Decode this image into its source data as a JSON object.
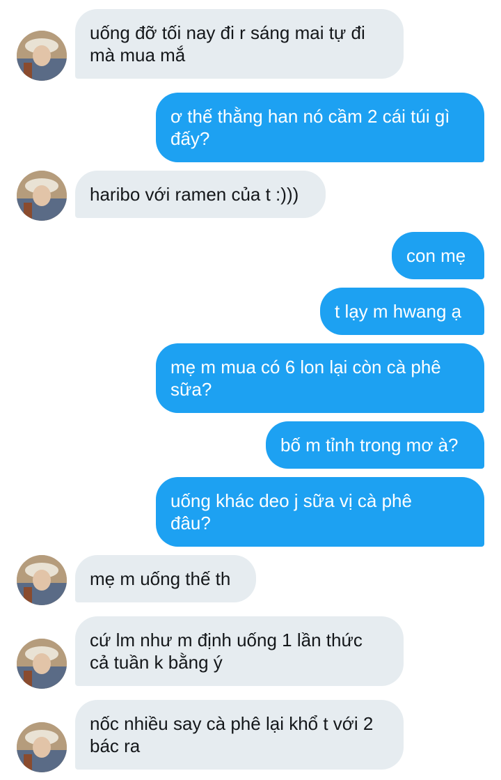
{
  "conversation": {
    "messages": [
      {
        "direction": "in",
        "text": "uống đỡ tối nay đi r sáng mai tự đi\nmà mua mắ"
      },
      {
        "direction": "out",
        "text": "ơ thế thằng han nó cầm 2 cái túi gì\nđấy?"
      },
      {
        "direction": "in",
        "text": "haribo với ramen của t :)))"
      },
      {
        "direction": "out",
        "text": "con mẹ"
      },
      {
        "direction": "out",
        "text": "t lạy m hwang ạ"
      },
      {
        "direction": "out",
        "text": "mẹ m mua có 6 lon lại còn cà phê\nsữa?"
      },
      {
        "direction": "out",
        "text": "bố m tỉnh trong mơ à?"
      },
      {
        "direction": "out",
        "text": "uống khác deo j sữa vị cà phê\nđâu?"
      },
      {
        "direction": "in",
        "text": "mẹ m uống thế th"
      },
      {
        "direction": "in",
        "text": "cứ lm như m định uống 1 lần thức\ncả tuần k bằng ý"
      },
      {
        "direction": "in",
        "text": "nốc nhiều say cà phê lại khổ t với 2\nbác ra"
      }
    ]
  },
  "colors": {
    "incoming_bubble": "#e6ecf0",
    "outgoing_bubble": "#1da1f2",
    "incoming_text": "#14171a",
    "outgoing_text": "#ffffff"
  },
  "icons": {
    "avatar": "contact-avatar-photo"
  }
}
